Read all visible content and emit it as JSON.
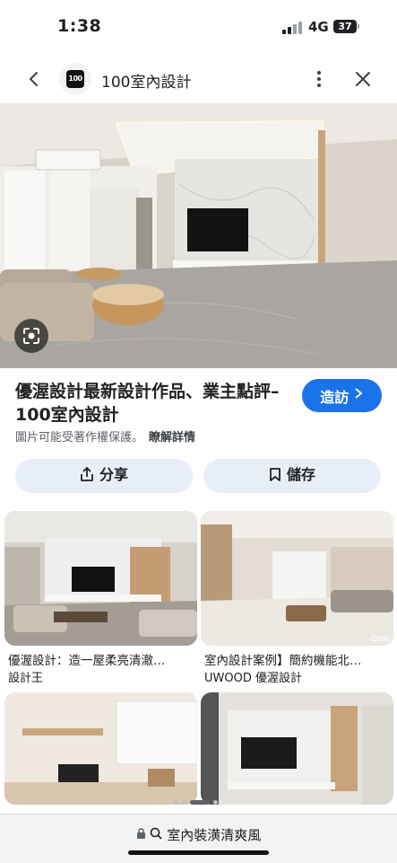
{
  "status": {
    "time": "1:38",
    "network": "4G",
    "battery": "37"
  },
  "header": {
    "site_name": "100室內設計",
    "logo_text": "100"
  },
  "result": {
    "title": "優渥設計最新設計作品、業主點評– 100室內設計",
    "visit_label": "造訪",
    "copyright_notice": "圖片可能受著作權保護。",
    "learn_more": "瞭解詳情"
  },
  "actions": {
    "share_label": "分享",
    "save_label": "儲存"
  },
  "related": [
    {
      "caption": "優渥設計：造一屋柔亮清澈…",
      "source": "設計王"
    },
    {
      "caption": "室內設計案例】簡約機能北…",
      "source": "UWOOD 優渥設計",
      "watermark": "Orde"
    }
  ],
  "bottom_bar": {
    "url": "室內裝潢清爽風"
  },
  "colors": {
    "accent": "#1a73e8",
    "action_bg": "#e8eef8"
  }
}
